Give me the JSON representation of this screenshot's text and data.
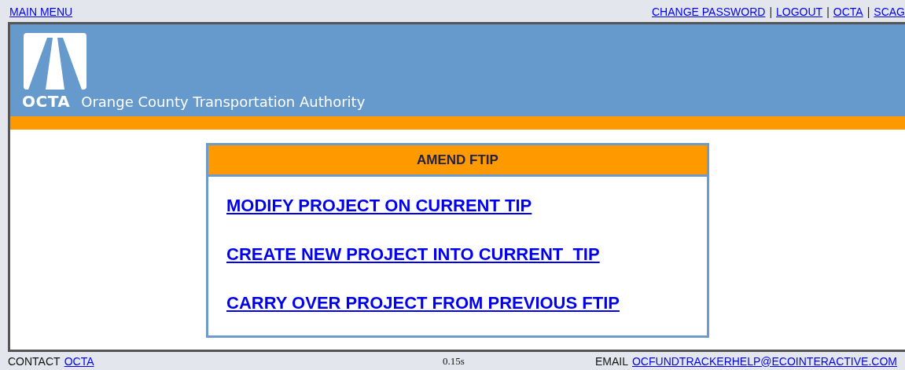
{
  "top_bar": {
    "left_link": "MAIN MENU",
    "right_links": [
      "CHANGE PASSWORD",
      "LOGOUT",
      "OCTA",
      "SCAG"
    ],
    "separator": "|"
  },
  "header": {
    "logo_text": "OCTA",
    "tagline": "Orange County Transportation Authority"
  },
  "panel": {
    "title": "AMEND FTIP",
    "links": [
      "MODIFY PROJECT ON CURRENT TIP",
      "CREATE NEW PROJECT INTO CURRENT  TIP",
      "CARRY OVER PROJECT FROM PREVIOUS FTIP"
    ]
  },
  "footer": {
    "contact_label": "CONTACT",
    "contact_link": "OCTA",
    "timing": "0.15s",
    "email_label": "EMAIL",
    "email_link": "OCFUNDTRACKERHELP@ECOINTERACTIVE.COM"
  }
}
